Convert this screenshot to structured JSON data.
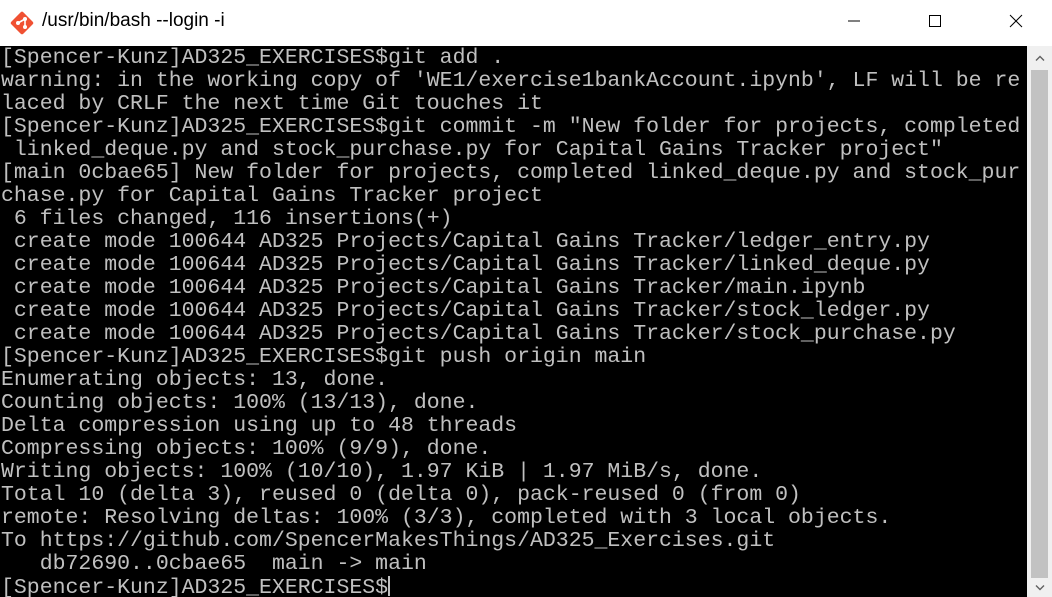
{
  "window": {
    "title": "/usr/bin/bash --login -i",
    "app_icon": "git-bash-icon",
    "controls": {
      "minimize": "minimize-icon",
      "maximize": "maximize-icon",
      "close": "close-icon"
    }
  },
  "terminal": {
    "background": "#000000",
    "foreground": "#c0c0c0",
    "lines": [
      "[Spencer-Kunz]AD325_EXERCISES$git add .",
      "warning: in the working copy of 'WE1/exercise1bankAccount.ipynb', LF will be re",
      "laced by CRLF the next time Git touches it",
      "[Spencer-Kunz]AD325_EXERCISES$git commit -m \"New folder for projects, completed",
      " linked_deque.py and stock_purchase.py for Capital Gains Tracker project\"",
      "[main 0cbae65] New folder for projects, completed linked_deque.py and stock_pur",
      "chase.py for Capital Gains Tracker project",
      " 6 files changed, 116 insertions(+)",
      " create mode 100644 AD325 Projects/Capital Gains Tracker/ledger_entry.py",
      " create mode 100644 AD325 Projects/Capital Gains Tracker/linked_deque.py",
      " create mode 100644 AD325 Projects/Capital Gains Tracker/main.ipynb",
      " create mode 100644 AD325 Projects/Capital Gains Tracker/stock_ledger.py",
      " create mode 100644 AD325 Projects/Capital Gains Tracker/stock_purchase.py",
      "[Spencer-Kunz]AD325_EXERCISES$git push origin main",
      "Enumerating objects: 13, done.",
      "Counting objects: 100% (13/13), done.",
      "Delta compression using up to 48 threads",
      "Compressing objects: 100% (9/9), done.",
      "Writing objects: 100% (10/10), 1.97 KiB | 1.97 MiB/s, done.",
      "Total 10 (delta 3), reused 0 (delta 0), pack-reused 0 (from 0)",
      "remote: Resolving deltas: 100% (3/3), completed with 3 local objects.",
      "To https://github.com/SpencerMakesThings/AD325_Exercises.git",
      "   db72690..0cbae65  main -> main"
    ],
    "prompt": "[Spencer-Kunz]AD325_EXERCISES$"
  },
  "scrollbar": {
    "up_icon": "scroll-up-arrow-icon",
    "down_icon": "scroll-down-arrow-icon"
  }
}
